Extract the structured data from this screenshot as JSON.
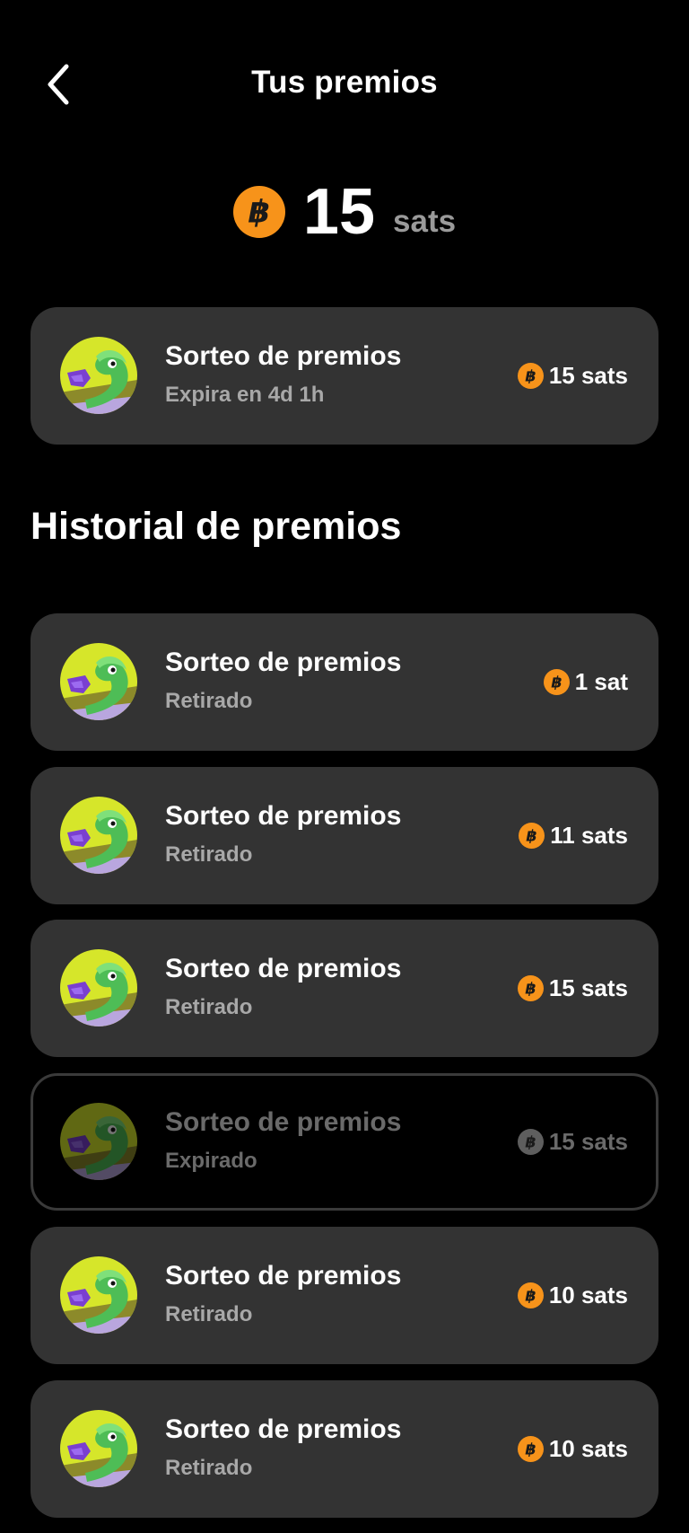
{
  "header": {
    "title": "Tus premios",
    "back_icon": "chevron-left-icon"
  },
  "balance": {
    "amount": "15",
    "unit": "sats",
    "icon": "bitcoin-coin-icon"
  },
  "current_prize": {
    "title": "Sorteo de premios",
    "subtitle": "Expira en 4d 1h",
    "amount": "15 sats"
  },
  "history": {
    "title": "Historial de premios",
    "items": [
      {
        "title": "Sorteo de premios",
        "status": "Retirado",
        "amount": "1 sat"
      },
      {
        "title": "Sorteo de premios",
        "status": "Retirado",
        "amount": "11 sats"
      },
      {
        "title": "Sorteo de premios",
        "status": "Retirado",
        "amount": "15 sats"
      },
      {
        "title": "Sorteo de premios",
        "status": "Expirado",
        "amount": "15 sats"
      },
      {
        "title": "Sorteo de premios",
        "status": "Retirado",
        "amount": "10 sats"
      },
      {
        "title": "Sorteo de premios",
        "status": "Retirado",
        "amount": "10 sats"
      }
    ]
  },
  "colors": {
    "background": "#000000",
    "card": "#333333",
    "bitcoin_orange": "#F7931A",
    "muted_text": "#A8A8A8",
    "expired_text": "#6A6A6A"
  }
}
